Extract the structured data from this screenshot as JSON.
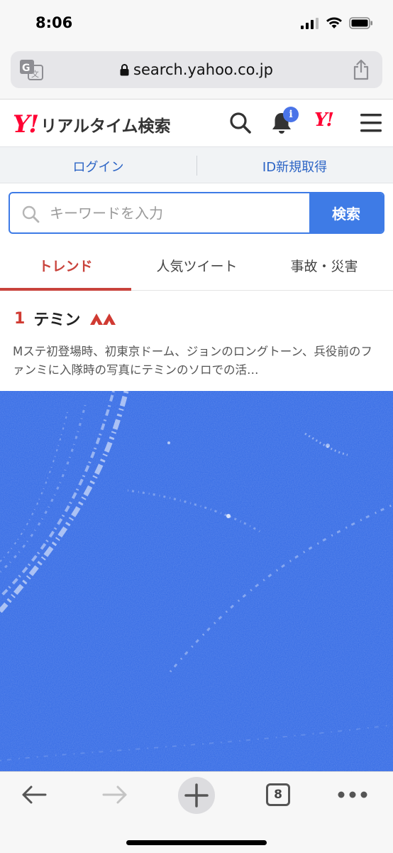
{
  "status_bar": {
    "time": "8:06"
  },
  "browser": {
    "url": "search.yahoo.co.jp"
  },
  "header": {
    "logo_mark": "Y!",
    "title": "リアルタイム検索",
    "notification_badge": "i",
    "yahoo_mark": "Y!"
  },
  "account": {
    "login": "ログイン",
    "register": "ID新規取得"
  },
  "search": {
    "placeholder": "キーワードを入力",
    "button": "検索"
  },
  "tabs": [
    {
      "label": "トレンド",
      "active": true
    },
    {
      "label": "人気ツイート",
      "active": false
    },
    {
      "label": "事故・災害",
      "active": false
    }
  ],
  "trend": {
    "rank": "1",
    "name": "テミン",
    "description": "Mステ初登場時、初東京ドーム、ジョンのロングトーン、兵役前のファンミに入隊時の写真にテミンのソロでの活…"
  },
  "bottom_nav": {
    "tab_count": "8"
  },
  "colors": {
    "accent_blue": "#3e7be6",
    "accent_red": "#c9433c",
    "image_blue": "#3a6fe6"
  }
}
